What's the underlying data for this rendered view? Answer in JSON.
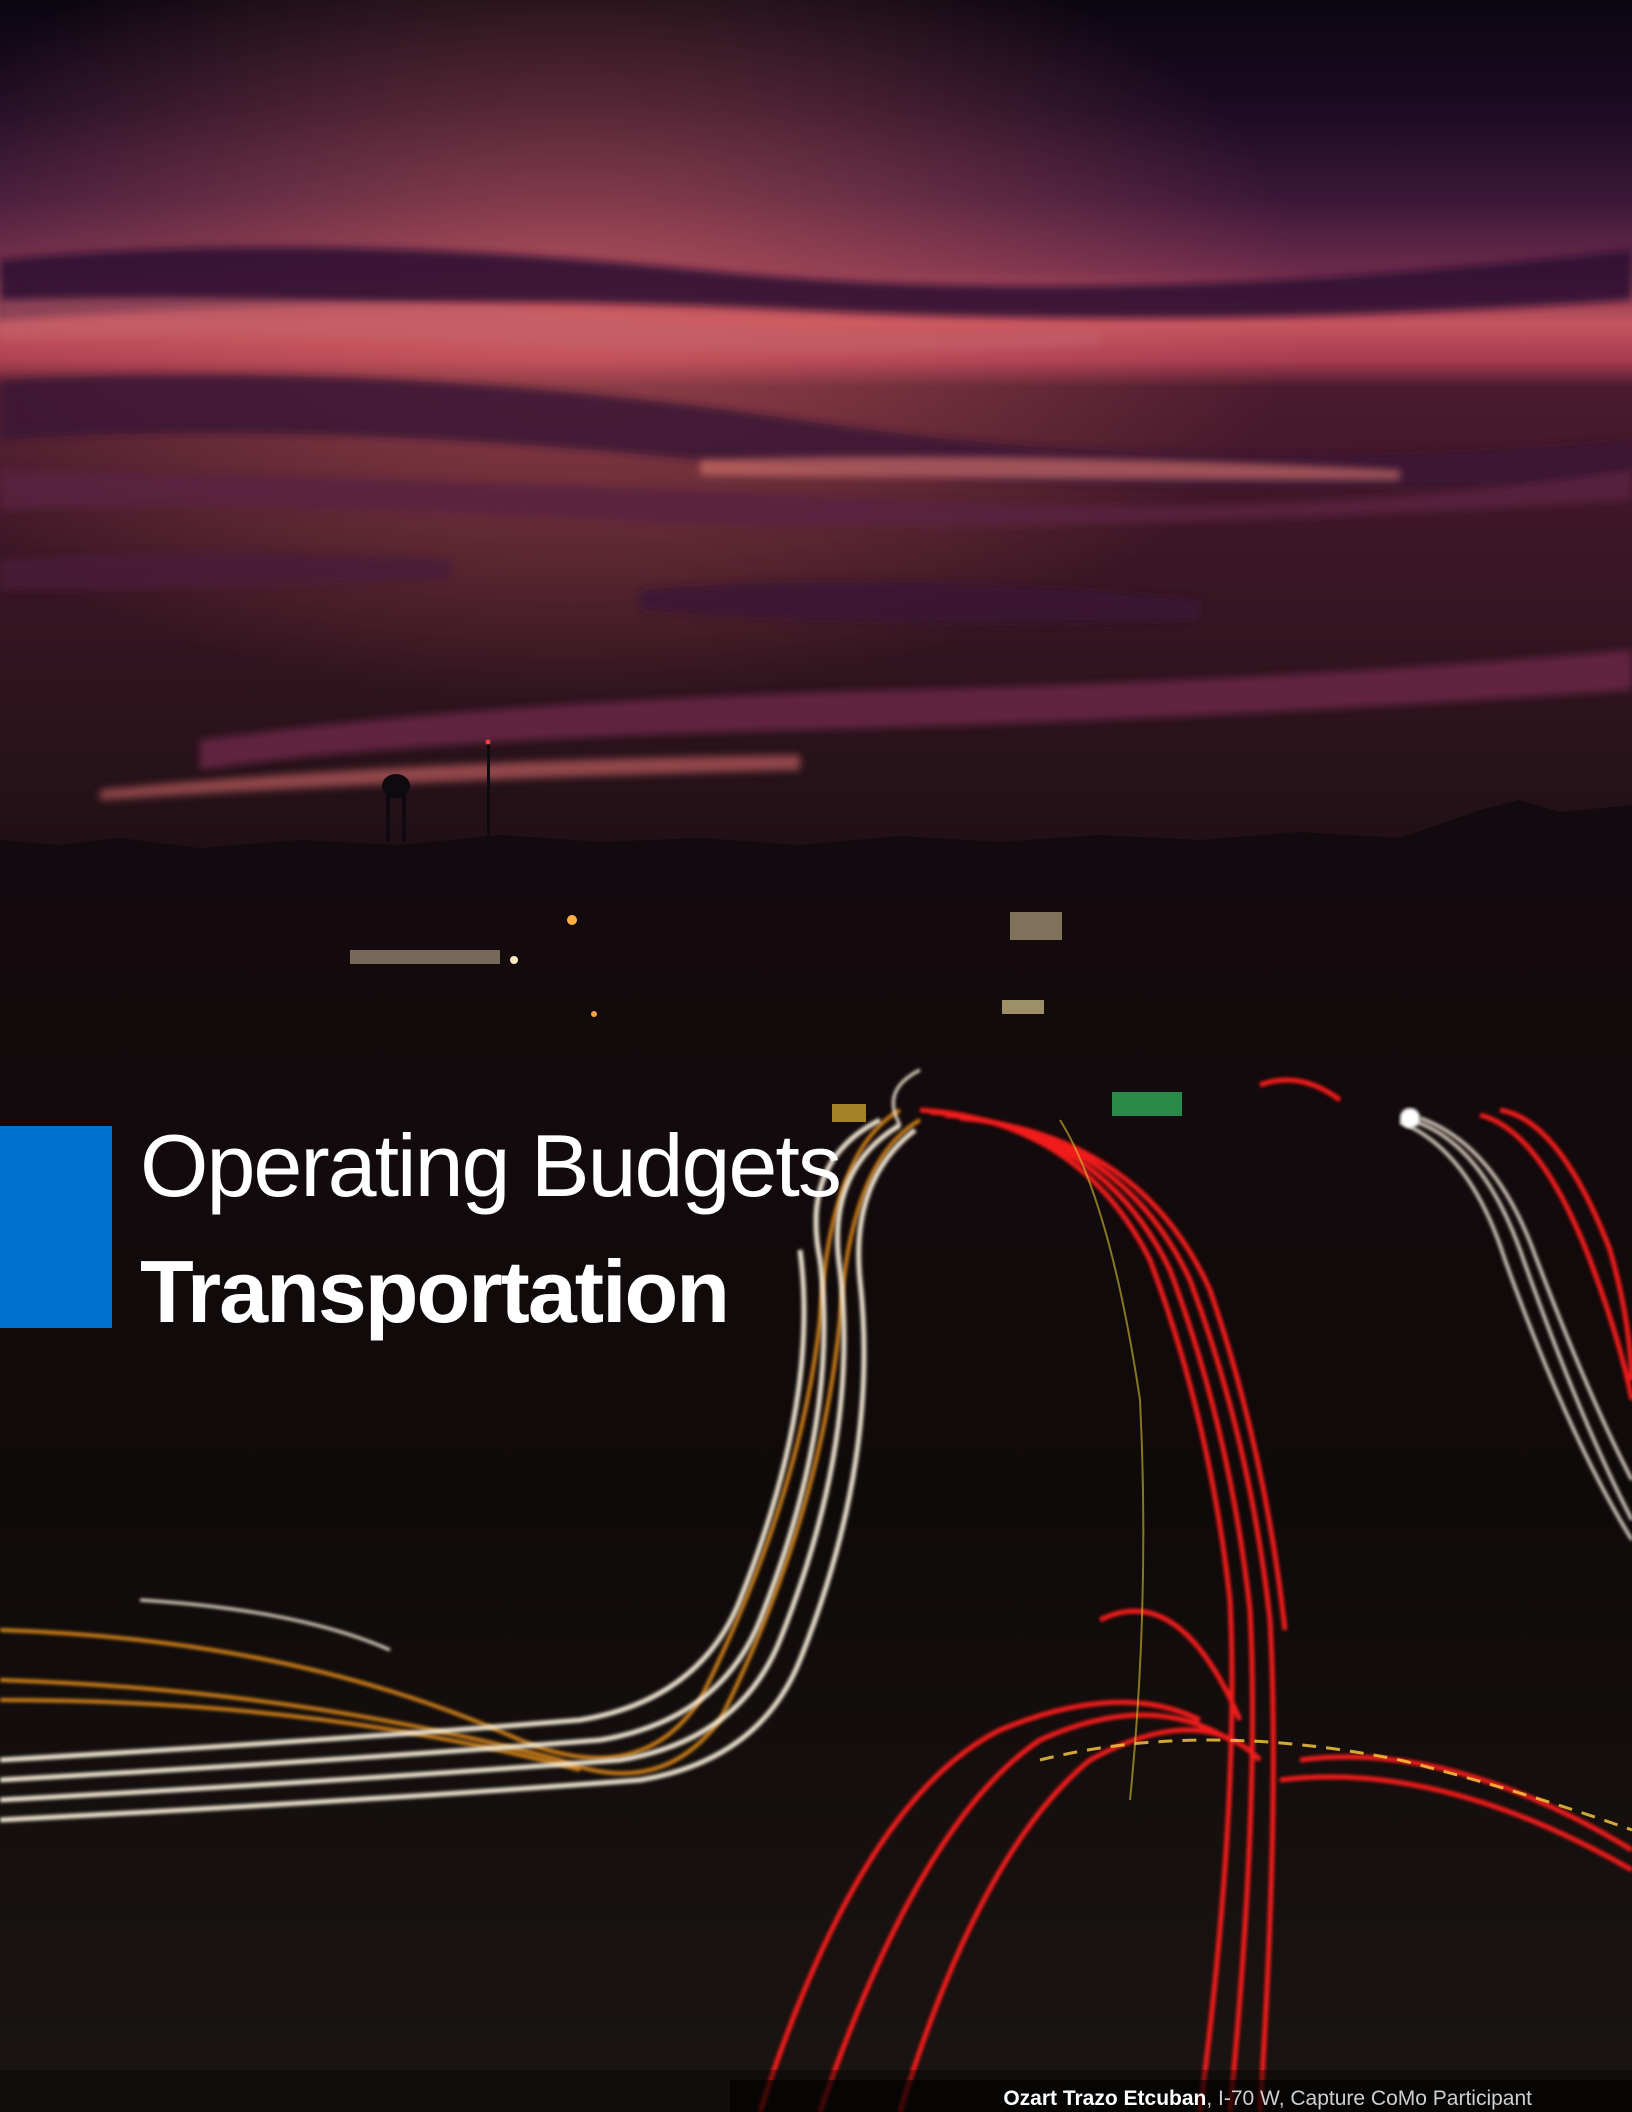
{
  "cover": {
    "title_line1": "Operating Budgets",
    "title_line2": "Transportation",
    "accent_color": "#0072ce"
  },
  "photo_credit": {
    "name": "Ozart Trazo Etcuban",
    "detail": ", I-70 W, Capture CoMo Participant"
  },
  "background": {
    "description_icon": "night-highway-photo",
    "colors": {
      "sky_top": "#120818",
      "sky_mid": "#4a1a44",
      "sunset_glow": "#c8505a",
      "ground": "#100808",
      "red_trails": "#ff1a1a",
      "white_trails": "#f3e9d2",
      "orange_trails": "#e08a1e"
    }
  }
}
